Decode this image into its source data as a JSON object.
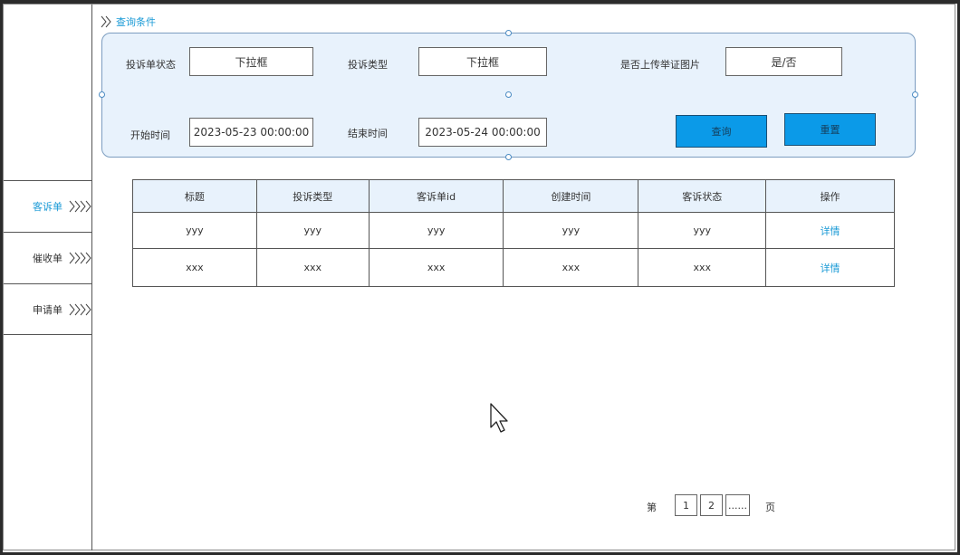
{
  "sidebar": {
    "items": [
      {
        "label": "客诉单",
        "icon": "chevrons-right-icon",
        "active": true
      },
      {
        "label": "催收单",
        "icon": "chevrons-right-icon",
        "active": false
      },
      {
        "label": "申请单",
        "icon": "chevrons-right-icon",
        "active": false
      }
    ]
  },
  "query": {
    "section_title": "查询条件",
    "fields": {
      "status_label": "投诉单状态",
      "status_value": "下拉框",
      "type_label": "投诉类型",
      "type_value": "下拉框",
      "image_label": "是否上传举证图片",
      "image_value": "是/否",
      "start_label": "开始时间",
      "start_value": "2023-05-23 00:00:00",
      "end_label": "结束时间",
      "end_value": "2023-05-24 00:00:00"
    },
    "search_button": "查询",
    "reset_button": "重置"
  },
  "table": {
    "headers": [
      "标题",
      "投诉类型",
      "客诉单id",
      "创建时间",
      "客诉状态",
      "操作"
    ],
    "rows": [
      [
        "yyy",
        "yyy",
        "yyy",
        "yyy",
        "yyy",
        "详情"
      ],
      [
        "xxx",
        "xxx",
        "xxx",
        "xxx",
        "xxx",
        "详情"
      ]
    ]
  },
  "pager": {
    "prefix": "第",
    "pages": [
      "1",
      "2",
      "......"
    ],
    "suffix": "页"
  },
  "colors": {
    "accent": "#1a9ad6",
    "panel_bg": "#e8f2fc",
    "button_bg": "#0b9ae8"
  }
}
